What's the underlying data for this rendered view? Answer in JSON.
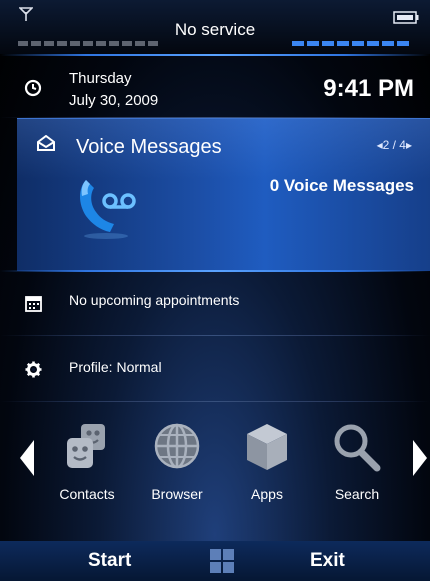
{
  "status_bar": {
    "title": "No service",
    "signal_icon": "antenna-icon",
    "battery_icon": "battery-icon",
    "signal_color": "#5e6470",
    "battery_bar_color": "#3b86f2"
  },
  "datetime": {
    "day": "Thursday",
    "date": "July 30, 2009",
    "time": "9:41 PM",
    "icon": "clock-icon"
  },
  "voice_messages": {
    "title": "Voice Messages",
    "pager": "◂2 / 4▸",
    "count_text": "0 Voice Messages",
    "icon": "voicemail-icon",
    "accent": "#1f5cc0"
  },
  "appointments": {
    "text": "No upcoming appointments",
    "icon": "calendar-icon"
  },
  "profile": {
    "text": "Profile: Normal",
    "icon": "gear-icon"
  },
  "apps": [
    {
      "label": "Contacts",
      "icon": "contacts-icon"
    },
    {
      "label": "Browser",
      "icon": "globe-icon"
    },
    {
      "label": "Apps",
      "icon": "box-icon"
    },
    {
      "label": "Search",
      "icon": "search-icon"
    }
  ],
  "softkeys": {
    "left": "Start",
    "right": "Exit",
    "center_icon": "windows-logo-icon"
  }
}
